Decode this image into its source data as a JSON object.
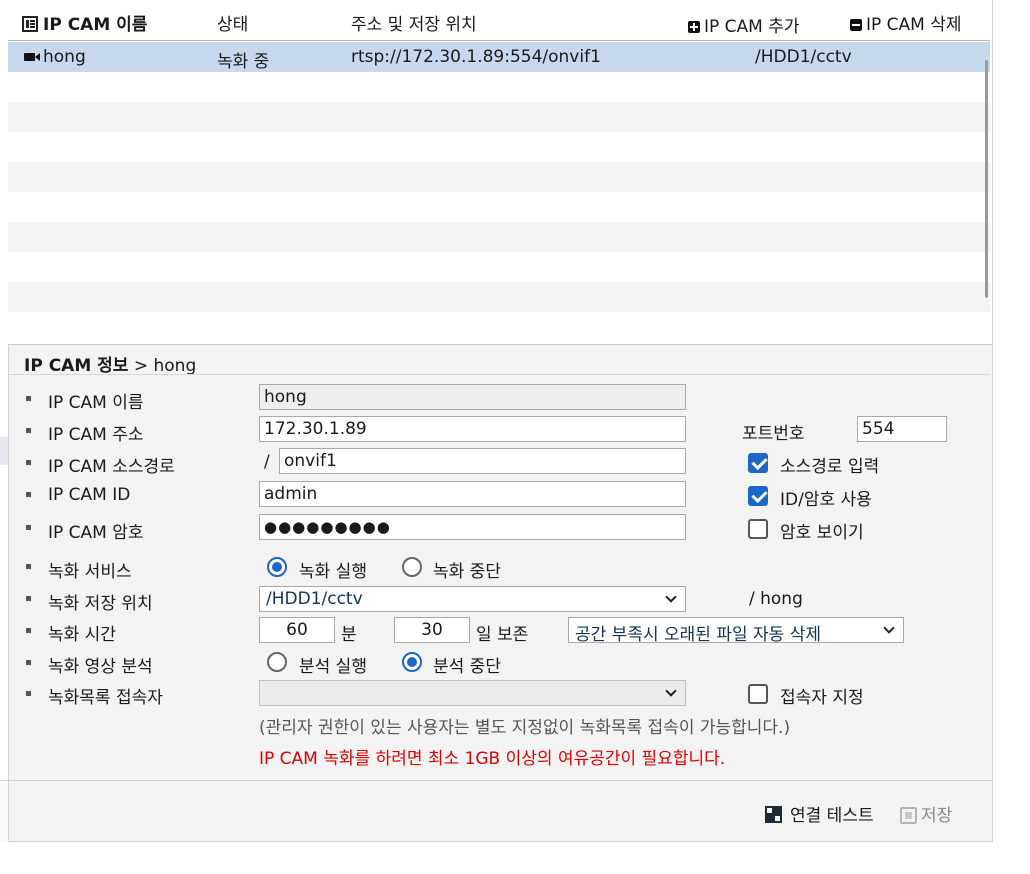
{
  "list": {
    "columns": {
      "name": "IP CAM 이름",
      "status": "상태",
      "address": "주소 및 저장 위치"
    },
    "add_label": "IP CAM 추가",
    "delete_label": "IP CAM 삭제",
    "rows": [
      {
        "name": "hong",
        "status": "녹화 중",
        "url": "rtsp://172.30.1.89:554/onvif1",
        "storage": "/HDD1/cctv"
      }
    ]
  },
  "info": {
    "title_bold": "IP CAM 정보",
    "title_rest": " > hong",
    "labels": {
      "name": "IP CAM 이름",
      "address": "IP CAM 주소",
      "source_path": "IP CAM 소스경로",
      "id": "IP CAM ID",
      "password": "IP CAM 암호",
      "record_service": "녹화 서비스",
      "record_location": "녹화 저장 위치",
      "record_time": "녹화 시간",
      "video_analysis": "녹화 영상 분석",
      "record_viewer": "녹화목록 접속자"
    },
    "values": {
      "name": "hong",
      "address": "172.30.1.89",
      "port_label": "포트번호",
      "port": "554",
      "slash": "/",
      "source_path": "onvif1",
      "id": "admin",
      "password": "●●●●●●●●●",
      "location": "/HDD1/cctv",
      "location_suffix": "/ hong",
      "minutes": "60",
      "minutes_unit": "분",
      "days": "30",
      "days_unit": "일 보존",
      "cleanup_policy": "공간 부족시 오래된 파일 자동 삭제",
      "viewer": ""
    },
    "checkboxes": {
      "source_path_input": {
        "label": "소스경로 입력",
        "checked": true
      },
      "use_id_password": {
        "label": "ID/암호 사용",
        "checked": true
      },
      "show_password": {
        "label": "암호 보이기",
        "checked": false
      },
      "assign_viewer": {
        "label": "접속자 지정",
        "checked": false
      }
    },
    "radios": {
      "record_on": {
        "label": "녹화 실행",
        "selected": true
      },
      "record_off": {
        "label": "녹화 중단",
        "selected": false
      },
      "analysis_on": {
        "label": "분석 실행",
        "selected": false
      },
      "analysis_off": {
        "label": "분석 중단",
        "selected": true
      }
    },
    "note": "(관리자 권한이 있는 사용자는 별도 지정없이 녹화목록 접속이 가능합니다.)",
    "warning": "IP CAM 녹화를 하려면 최소 1GB 이상의 여유공간이 필요합니다.",
    "warning_color": "#e00000"
  },
  "footer": {
    "test_label": "연결 테스트",
    "save_label": "저장"
  },
  "colors": {
    "selected_row": "#c6d7ee",
    "accent": "#1b66c9"
  }
}
